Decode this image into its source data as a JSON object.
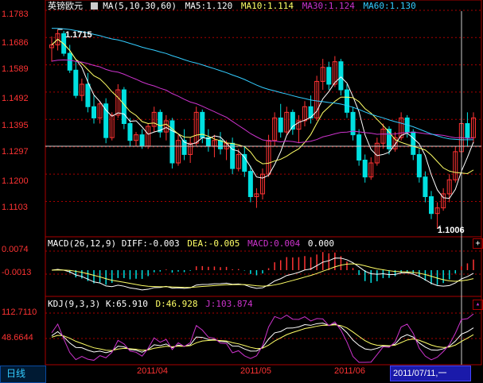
{
  "instrument": "英镑欧元",
  "colors": {
    "up": "#ff3333",
    "down": "#00e0e0",
    "ma5": "#ffffff",
    "ma10": "#ffff66",
    "ma30": "#cc33cc",
    "ma60": "#33ccff",
    "grid": "#aa0000",
    "text_white": "#ffffff"
  },
  "main_panel": {
    "indicator": "MA(5,10,30,60)",
    "ma5_label": "MA5:1.120",
    "ma10_label": "MA10:1.114",
    "ma30_label": "MA30:1.124",
    "ma60_label": "MA60:1.130",
    "y_ticks": [
      "1.1783",
      "1.1686",
      "1.1589",
      "1.1492",
      "1.1395",
      "1.1297",
      "1.1200",
      "1.1103"
    ],
    "y_ticks_values": [
      1.1783,
      1.1686,
      1.1589,
      1.1492,
      1.1395,
      1.1297,
      1.12,
      1.1103
    ],
    "high_marker": "1.1715",
    "low_marker": "1.1006"
  },
  "macd_panel": {
    "indicator": "MACD(26,12,9)",
    "diff_label": "DIFF:-0.003",
    "dea_label": "DEA:-0.005",
    "macd_label": "MACD:0.004",
    "extra_value": "0.000",
    "y_ticks": [
      "0.0074",
      "-0.0013"
    ]
  },
  "kdj_panel": {
    "indicator": "KDJ(9,3,3)",
    "k_label": "K:65.910",
    "d_label": "D:46.928",
    "j_label": "J:103.874",
    "y_ticks": [
      "112.7110",
      "48.6644"
    ]
  },
  "x_axis": {
    "labels": [
      "2011/04",
      "2011/05",
      "2011/06"
    ],
    "cursor_date": "2011/07/11,一"
  },
  "period_tab": "日线",
  "chart_data": {
    "type": "candlestick",
    "title": "英镑欧元",
    "ylim": [
      1.098,
      1.178
    ],
    "candles": [
      [
        1.165,
        1.169,
        1.16,
        1.166
      ],
      [
        1.166,
        1.1715,
        1.164,
        1.17
      ],
      [
        1.17,
        1.171,
        1.162,
        1.163
      ],
      [
        1.163,
        1.166,
        1.156,
        1.157
      ],
      [
        1.157,
        1.16,
        1.147,
        1.148
      ],
      [
        1.148,
        1.154,
        1.146,
        1.152
      ],
      [
        1.152,
        1.156,
        1.142,
        1.144
      ],
      [
        1.144,
        1.148,
        1.138,
        1.14
      ],
      [
        1.14,
        1.146,
        1.138,
        1.145
      ],
      [
        1.145,
        1.147,
        1.131,
        1.133
      ],
      [
        1.133,
        1.142,
        1.132,
        1.141
      ],
      [
        1.141,
        1.152,
        1.14,
        1.15
      ],
      [
        1.15,
        1.151,
        1.136,
        1.138
      ],
      [
        1.138,
        1.14,
        1.13,
        1.132
      ],
      [
        1.132,
        1.135,
        1.13,
        1.134
      ],
      [
        1.134,
        1.136,
        1.129,
        1.13
      ],
      [
        1.13,
        1.138,
        1.129,
        1.137
      ],
      [
        1.137,
        1.144,
        1.135,
        1.142
      ],
      [
        1.142,
        1.143,
        1.133,
        1.135
      ],
      [
        1.135,
        1.141,
        1.132,
        1.139
      ],
      [
        1.139,
        1.14,
        1.122,
        1.124
      ],
      [
        1.124,
        1.134,
        1.123,
        1.132
      ],
      [
        1.132,
        1.136,
        1.125,
        1.127
      ],
      [
        1.127,
        1.133,
        1.124,
        1.131
      ],
      [
        1.131,
        1.144,
        1.13,
        1.142
      ],
      [
        1.142,
        1.143,
        1.131,
        1.133
      ],
      [
        1.133,
        1.136,
        1.128,
        1.13
      ],
      [
        1.13,
        1.134,
        1.126,
        1.132
      ],
      [
        1.132,
        1.135,
        1.127,
        1.129
      ],
      [
        1.129,
        1.132,
        1.125,
        1.131
      ],
      [
        1.131,
        1.133,
        1.12,
        1.122
      ],
      [
        1.122,
        1.129,
        1.121,
        1.127
      ],
      [
        1.127,
        1.13,
        1.119,
        1.121
      ],
      [
        1.121,
        1.123,
        1.11,
        1.112
      ],
      [
        1.112,
        1.115,
        1.108,
        1.113
      ],
      [
        1.113,
        1.122,
        1.111,
        1.12
      ],
      [
        1.12,
        1.134,
        1.119,
        1.132
      ],
      [
        1.132,
        1.142,
        1.13,
        1.14
      ],
      [
        1.14,
        1.145,
        1.133,
        1.135
      ],
      [
        1.135,
        1.144,
        1.134,
        1.142
      ],
      [
        1.142,
        1.143,
        1.134,
        1.136
      ],
      [
        1.136,
        1.141,
        1.131,
        1.139
      ],
      [
        1.139,
        1.146,
        1.137,
        1.144
      ],
      [
        1.144,
        1.148,
        1.138,
        1.14
      ],
      [
        1.14,
        1.155,
        1.139,
        1.153
      ],
      [
        1.153,
        1.161,
        1.15,
        1.158
      ],
      [
        1.158,
        1.16,
        1.15,
        1.152
      ],
      [
        1.152,
        1.162,
        1.151,
        1.16
      ],
      [
        1.16,
        1.161,
        1.148,
        1.15
      ],
      [
        1.15,
        1.152,
        1.14,
        1.142
      ],
      [
        1.142,
        1.144,
        1.132,
        1.134
      ],
      [
        1.134,
        1.136,
        1.123,
        1.125
      ],
      [
        1.125,
        1.127,
        1.117,
        1.119
      ],
      [
        1.119,
        1.126,
        1.118,
        1.124
      ],
      [
        1.124,
        1.133,
        1.123,
        1.131
      ],
      [
        1.131,
        1.138,
        1.129,
        1.136
      ],
      [
        1.136,
        1.137,
        1.127,
        1.129
      ],
      [
        1.129,
        1.135,
        1.128,
        1.133
      ],
      [
        1.133,
        1.142,
        1.132,
        1.14
      ],
      [
        1.14,
        1.141,
        1.133,
        1.135
      ],
      [
        1.135,
        1.136,
        1.125,
        1.127
      ],
      [
        1.127,
        1.129,
        1.117,
        1.119
      ],
      [
        1.119,
        1.121,
        1.11,
        1.112
      ],
      [
        1.112,
        1.114,
        1.104,
        1.106
      ],
      [
        1.106,
        1.11,
        1.1006,
        1.108
      ],
      [
        1.108,
        1.115,
        1.107,
        1.113
      ],
      [
        1.113,
        1.12,
        1.11,
        1.118
      ],
      [
        1.118,
        1.13,
        1.117,
        1.128
      ],
      [
        1.128,
        1.14,
        1.126,
        1.138
      ],
      [
        1.138,
        1.142,
        1.13,
        1.133
      ],
      [
        1.133,
        1.142,
        1.131,
        1.14
      ]
    ]
  }
}
